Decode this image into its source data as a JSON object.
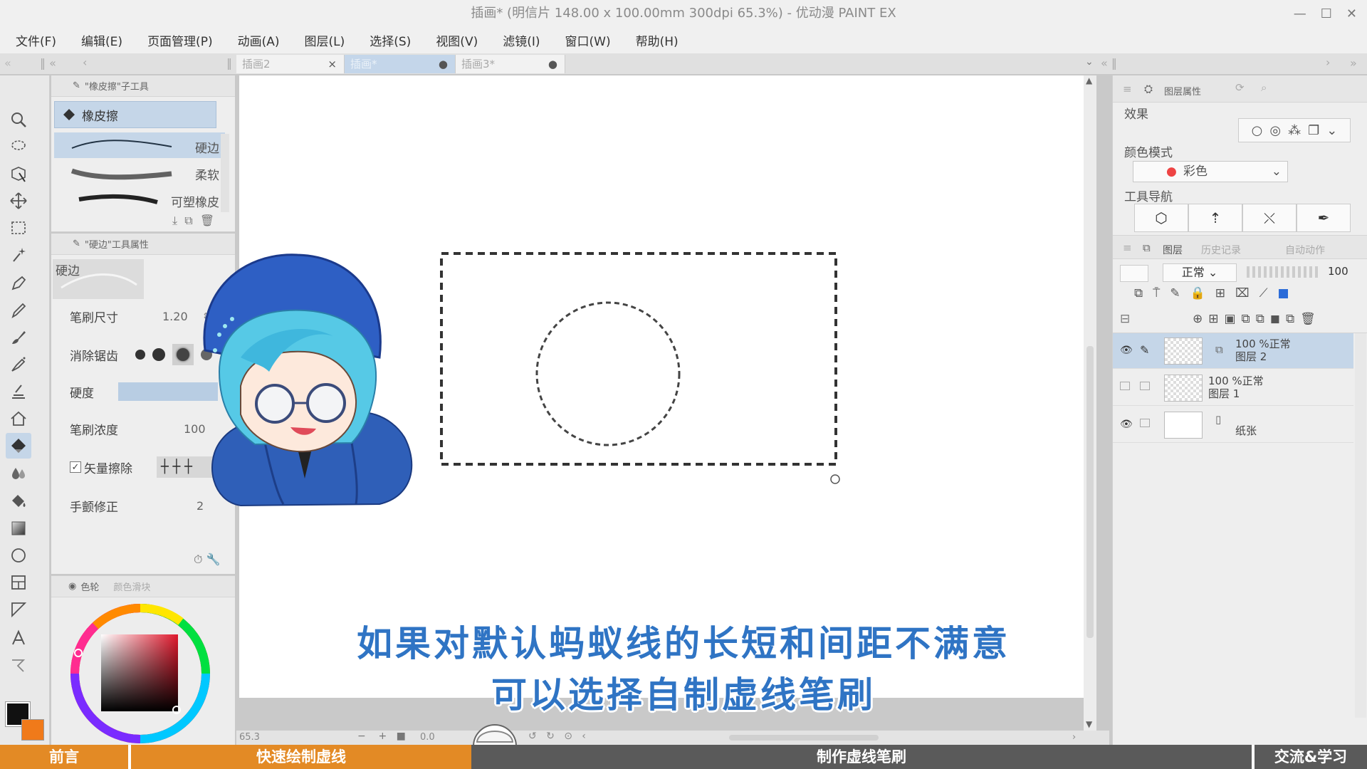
{
  "window": {
    "title": "插画* (明信片 148.00 x 100.00mm 300dpi 65.3%) - 优动漫 PAINT EX"
  },
  "menu": [
    "文件(F)",
    "编辑(E)",
    "页面管理(P)",
    "动画(A)",
    "图层(L)",
    "选择(S)",
    "视图(V)",
    "滤镜(I)",
    "窗口(W)",
    "帮助(H)"
  ],
  "tabs": [
    {
      "label": "插画2",
      "marker": "×"
    },
    {
      "label": "插画*",
      "marker": "●"
    },
    {
      "label": "插画3*",
      "marker": "●"
    }
  ],
  "subtool": {
    "header": "\"橡皮擦\"子工具",
    "selected": "橡皮擦",
    "brushes": [
      "硬边",
      "柔软",
      "可塑橡皮"
    ]
  },
  "tool_property": {
    "header": "\"硬边\"工具属性",
    "preview_label": "硬边",
    "brush_size_label": "笔刷尺寸",
    "brush_size_value": "1.20",
    "antialias_label": "消除锯齿",
    "hardness_label": "硬度",
    "density_label": "笔刷浓度",
    "density_value": "100",
    "vector_erase_label": "矢量擦除",
    "stabilization_label": "手颤修正",
    "stabilization_value": "2"
  },
  "color_panel": {
    "tab_wheel": "色轮",
    "tab_other": "颜色滑块"
  },
  "layer_property": {
    "header": "图层属性",
    "effect_label": "效果",
    "color_mode_label": "颜色模式",
    "color_mode_value": "彩色",
    "tool_nav_label": "工具导航"
  },
  "layer_panel": {
    "tabs": [
      "图层",
      "历史记录",
      "自动动作"
    ],
    "blend_mode": "正常",
    "opacity": "100",
    "layers": [
      {
        "opacity_mode": "100 %正常",
        "name": "图层 2",
        "selected": true,
        "visible": true
      },
      {
        "opacity_mode": "100 %正常",
        "name": "图层 1",
        "selected": false,
        "visible": false
      },
      {
        "opacity_mode": "",
        "name": "纸张",
        "selected": false,
        "visible": true
      }
    ]
  },
  "status": {
    "zoom": "65.3",
    "angle": "0.0"
  },
  "caption": {
    "line1": "如果对默认蚂蚁线的长短和间距不满意",
    "line2": "可以选择自制虚线笔刷"
  },
  "chapters": [
    "前言",
    "快速绘制虚线",
    "制作虚线笔刷",
    "交流&学习"
  ],
  "colors": {
    "accent_chapter": "#e38a25",
    "caption_text": "#2f74c4",
    "selection_blue": "#c5d6e8"
  }
}
